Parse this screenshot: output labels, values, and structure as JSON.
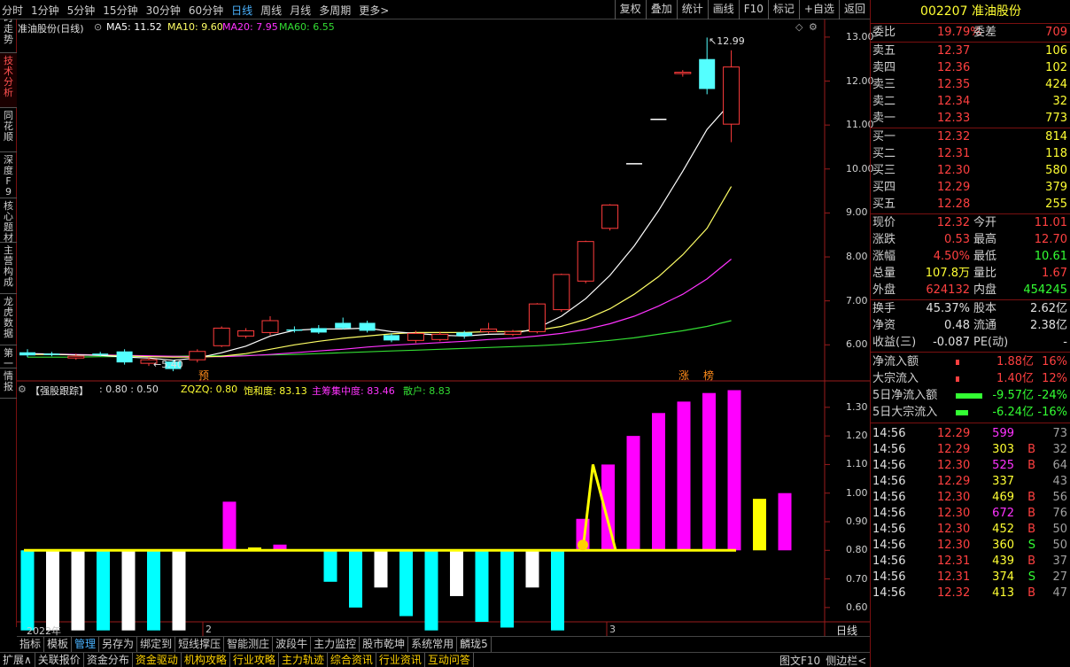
{
  "toolbar": {
    "periods": [
      "分时",
      "1分钟",
      "5分钟",
      "15分钟",
      "30分钟",
      "60分钟",
      "日线",
      "周线",
      "月线",
      "多周期",
      "更多>"
    ],
    "active_period": "日线",
    "right_tools": [
      "复权",
      "叠加",
      "统计",
      "画线",
      "F10",
      "标记",
      "+自选",
      "返回"
    ]
  },
  "left_tabs": [
    {
      "label": "分时走势",
      "active": false
    },
    {
      "label": "技术分析",
      "active": true
    },
    {
      "label": "同花顺",
      "active": false
    },
    {
      "label": "深度F9",
      "active": false
    },
    {
      "label": "核心题材",
      "active": false
    },
    {
      "label": "主营构成",
      "active": false
    },
    {
      "label": "龙虎数据",
      "active": false
    },
    {
      "label": "第一",
      "active": false
    },
    {
      "label": "情报",
      "active": false
    }
  ],
  "main_header": {
    "title": "准油股份(日线)",
    "ma5": "MA5: 11.52",
    "ma10": "MA10: 9.60",
    "ma20": "MA20: 7.95",
    "ma60": "MA60: 6.55"
  },
  "price_axis": [
    "13.00",
    "12.00",
    "11.00",
    "10.00",
    "9.00",
    "8.00",
    "7.00",
    "6.00"
  ],
  "high_mark": "12.99",
  "low_mark": "5.40",
  "event_marks": {
    "pre": "预",
    "up": "涨",
    "rank": "榜"
  },
  "sub_header": {
    "name": "【强股跟踪】",
    "vals": ": 0.80 : 0.50",
    "zqzq": "ZQZQ: 0.80",
    "bhd": "饱和度: 83.13",
    "zczd": "主筹集中度: 83.46",
    "sh": "散户: 8.83"
  },
  "sub_axis": [
    "1.30",
    "1.20",
    "1.10",
    "1.00",
    "0.90",
    "0.80",
    "0.70",
    "0.60"
  ],
  "sub_footer": "日线",
  "date_labels": [
    "2022年",
    "2",
    "3"
  ],
  "colors": {
    "up": "#ff3c3c",
    "down": "#54ffff",
    "ma5": "#ffffff",
    "ma10": "#ffff66",
    "ma20": "#ff33ff",
    "ma60": "#33dd33",
    "sub_magenta": "#ff00ff",
    "sub_cyan": "#00ffff",
    "sub_white": "#ffffff",
    "sub_yellow": "#ffff00"
  },
  "chart_data": [
    {
      "type": "candlestick",
      "title": "准油股份(日线)",
      "ylim": [
        5.2,
        13.3
      ],
      "candles": [
        {
          "o": 5.83,
          "c": 5.76,
          "h": 5.9,
          "l": 5.72
        },
        {
          "o": 5.8,
          "c": 5.78,
          "h": 5.84,
          "l": 5.74
        },
        {
          "o": 5.7,
          "c": 5.74,
          "h": 5.8,
          "l": 5.66
        },
        {
          "o": 5.8,
          "c": 5.78,
          "h": 5.84,
          "l": 5.74
        },
        {
          "o": 5.85,
          "c": 5.6,
          "h": 5.9,
          "l": 5.55
        },
        {
          "o": 5.58,
          "c": 5.66,
          "h": 5.72,
          "l": 5.52
        },
        {
          "o": 5.62,
          "c": 5.45,
          "h": 5.66,
          "l": 5.4
        },
        {
          "o": 5.66,
          "c": 5.85,
          "h": 5.9,
          "l": 5.6
        },
        {
          "o": 5.98,
          "c": 6.38,
          "h": 6.42,
          "l": 5.95
        },
        {
          "o": 6.2,
          "c": 6.32,
          "h": 6.38,
          "l": 6.15
        },
        {
          "o": 6.28,
          "c": 6.55,
          "h": 6.65,
          "l": 6.22
        },
        {
          "o": 6.35,
          "c": 6.34,
          "h": 6.42,
          "l": 6.28
        },
        {
          "o": 6.38,
          "c": 6.28,
          "h": 6.45,
          "l": 6.25
        },
        {
          "o": 6.5,
          "c": 6.38,
          "h": 6.62,
          "l": 6.35
        },
        {
          "o": 6.5,
          "c": 6.32,
          "h": 6.55,
          "l": 6.28
        },
        {
          "o": 6.22,
          "c": 6.1,
          "h": 6.26,
          "l": 6.06
        },
        {
          "o": 6.1,
          "c": 6.26,
          "h": 6.32,
          "l": 6.04
        },
        {
          "o": 6.12,
          "c": 6.24,
          "h": 6.3,
          "l": 6.08
        },
        {
          "o": 6.28,
          "c": 6.2,
          "h": 6.32,
          "l": 6.14
        },
        {
          "o": 6.3,
          "c": 6.36,
          "h": 6.5,
          "l": 6.26
        },
        {
          "o": 6.24,
          "c": 6.3,
          "h": 6.34,
          "l": 6.2
        },
        {
          "o": 6.3,
          "c": 6.93,
          "h": 6.95,
          "l": 6.26
        },
        {
          "o": 6.8,
          "c": 7.6,
          "h": 7.62,
          "l": 6.75
        },
        {
          "o": 7.45,
          "c": 8.35,
          "h": 8.37,
          "l": 7.4
        },
        {
          "o": 8.65,
          "c": 9.18,
          "h": 9.2,
          "l": 8.6
        },
        {
          "o": 10.12,
          "c": 10.12,
          "h": 10.12,
          "l": 10.12
        },
        {
          "o": 11.13,
          "c": 11.13,
          "h": 11.13,
          "l": 11.13
        },
        {
          "o": 12.2,
          "c": 12.2,
          "h": 12.25,
          "l": 12.1
        },
        {
          "o": 12.5,
          "c": 11.82,
          "h": 12.99,
          "l": 11.7
        },
        {
          "o": 11.02,
          "c": 12.32,
          "h": 12.7,
          "l": 10.61
        }
      ],
      "ma5": [
        5.8,
        5.79,
        5.77,
        5.76,
        5.72,
        5.7,
        5.65,
        5.7,
        5.82,
        5.97,
        6.2,
        6.33,
        6.36,
        6.36,
        6.38,
        6.3,
        6.26,
        6.22,
        6.2,
        6.24,
        6.25,
        6.38,
        6.65,
        7.05,
        7.58,
        8.25,
        9.05,
        9.95,
        10.9,
        11.52
      ],
      "ma10": [
        5.78,
        5.78,
        5.77,
        5.76,
        5.75,
        5.73,
        5.72,
        5.72,
        5.74,
        5.8,
        5.9,
        6.0,
        6.08,
        6.15,
        6.2,
        6.25,
        6.28,
        6.28,
        6.28,
        6.3,
        6.3,
        6.33,
        6.42,
        6.58,
        6.82,
        7.15,
        7.55,
        8.05,
        8.65,
        9.6
      ],
      "ma20": [
        5.8,
        5.79,
        5.78,
        5.77,
        5.76,
        5.75,
        5.74,
        5.73,
        5.73,
        5.75,
        5.78,
        5.82,
        5.86,
        5.9,
        5.95,
        5.99,
        6.02,
        6.05,
        6.08,
        6.12,
        6.15,
        6.2,
        6.26,
        6.35,
        6.48,
        6.65,
        6.88,
        7.15,
        7.5,
        7.95
      ],
      "ma60": [
        5.72,
        5.72,
        5.72,
        5.73,
        5.73,
        5.74,
        5.74,
        5.75,
        5.75,
        5.76,
        5.77,
        5.78,
        5.8,
        5.82,
        5.84,
        5.86,
        5.88,
        5.9,
        5.92,
        5.94,
        5.96,
        5.98,
        6.01,
        6.05,
        6.1,
        6.16,
        6.24,
        6.32,
        6.42,
        6.55
      ]
    },
    {
      "type": "bar",
      "title": "【强股跟踪】",
      "ylim": [
        0.55,
        1.38
      ],
      "baseline": 0.8,
      "values": [
        0.52,
        0.52,
        0.52,
        0.52,
        0.52,
        0.52,
        0.52,
        0.8,
        0.97,
        0.81,
        0.82,
        0.8,
        0.69,
        0.6,
        0.67,
        0.57,
        0.52,
        0.64,
        0.55,
        0.53,
        0.67,
        0.52,
        0.91,
        1.1,
        1.2,
        1.28,
        1.32,
        1.35,
        1.36,
        0.98,
        1.0
      ],
      "colors": [
        "c",
        "w",
        "w",
        "c",
        "w",
        "c",
        "w",
        "n",
        "m",
        "y",
        "m",
        "n",
        "c",
        "c",
        "w",
        "c",
        "c",
        "w",
        "c",
        "c",
        "w",
        "c",
        "m",
        "m",
        "m",
        "m",
        "m",
        "m",
        "m",
        "y",
        "m"
      ],
      "peak": [
        {
          "x": 22,
          "y": 0.8
        },
        {
          "x": 22.4,
          "y": 1.1
        },
        {
          "x": 23.3,
          "y": 0.8
        }
      ]
    }
  ],
  "quote": {
    "code": "002207",
    "name": "准油股份",
    "weibi_label": "委比",
    "weibi_value": "19.79%",
    "weicha_label": "委差",
    "weicha_value": "709",
    "sell": [
      {
        "label": "卖五",
        "price": "12.37",
        "vol": "106"
      },
      {
        "label": "卖四",
        "price": "12.36",
        "vol": "102"
      },
      {
        "label": "卖三",
        "price": "12.35",
        "vol": "424"
      },
      {
        "label": "卖二",
        "price": "12.34",
        "vol": "32"
      },
      {
        "label": "卖一",
        "price": "12.33",
        "vol": "773"
      }
    ],
    "buy": [
      {
        "label": "买一",
        "price": "12.32",
        "vol": "814"
      },
      {
        "label": "买二",
        "price": "12.31",
        "vol": "118"
      },
      {
        "label": "买三",
        "price": "12.30",
        "vol": "580"
      },
      {
        "label": "买四",
        "price": "12.29",
        "vol": "379"
      },
      {
        "label": "买五",
        "price": "12.28",
        "vol": "255"
      }
    ],
    "stats": [
      {
        "l1": "现价",
        "v1": "12.32",
        "c1": "#ff4040",
        "l2": "今开",
        "v2": "11.01",
        "c2": "#ff4040"
      },
      {
        "l1": "涨跌",
        "v1": "0.53",
        "c1": "#ff4040",
        "l2": "最高",
        "v2": "12.70",
        "c2": "#ff4040"
      },
      {
        "l1": "涨幅",
        "v1": "4.50%",
        "c1": "#ff4040",
        "l2": "最低",
        "v2": "10.61",
        "c2": "#33ff33"
      },
      {
        "l1": "总量",
        "v1": "107.8万",
        "c1": "#ffff33",
        "l2": "量比",
        "v2": "1.67",
        "c2": "#ff4040"
      },
      {
        "l1": "外盘",
        "v1": "624132",
        "c1": "#ff4040",
        "l2": "内盘",
        "v2": "454245",
        "c2": "#33ff33"
      }
    ],
    "stats2": [
      {
        "l1": "换手",
        "v1": "45.37%",
        "l2": "股本",
        "v2": "2.62亿"
      },
      {
        "l1": "净资",
        "v1": "0.48",
        "l2": "流通",
        "v2": "2.38亿"
      },
      {
        "l1": "收益(三)",
        "v1": "-0.087",
        "l2": "PE(动)",
        "v2": "-"
      }
    ],
    "flows": [
      {
        "label": "净流入额",
        "value": "1.88亿",
        "pct": "16%",
        "color": "#ff4040",
        "bar": 0.06
      },
      {
        "label": "大宗流入",
        "value": "1.40亿",
        "pct": "12%",
        "color": "#ff4040",
        "bar": 0.05
      },
      {
        "label": "5日净流入额",
        "value": "-9.57亿",
        "pct": "-24%",
        "color": "#33ff33",
        "bar": 1
      },
      {
        "label": "5日大宗流入",
        "value": "-6.24亿",
        "pct": "-16%",
        "color": "#33ff33",
        "bar": 0.45
      }
    ],
    "ticks": [
      {
        "t": "14:56",
        "p": "12.29",
        "v": "599",
        "f": "",
        "n": "73",
        "vc": "#ff33ff"
      },
      {
        "t": "14:56",
        "p": "12.29",
        "v": "303",
        "f": "B",
        "n": "32",
        "vc": "#ffff33"
      },
      {
        "t": "14:56",
        "p": "12.30",
        "v": "525",
        "f": "B",
        "n": "64",
        "vc": "#ff33ff"
      },
      {
        "t": "14:56",
        "p": "12.29",
        "v": "337",
        "f": "",
        "n": "43",
        "vc": "#ffff33"
      },
      {
        "t": "14:56",
        "p": "12.30",
        "v": "469",
        "f": "B",
        "n": "56",
        "vc": "#ffff33"
      },
      {
        "t": "14:56",
        "p": "12.30",
        "v": "672",
        "f": "B",
        "n": "76",
        "vc": "#ff33ff"
      },
      {
        "t": "14:56",
        "p": "12.30",
        "v": "452",
        "f": "B",
        "n": "50",
        "vc": "#ffff33"
      },
      {
        "t": "14:56",
        "p": "12.30",
        "v": "360",
        "f": "S",
        "n": "50",
        "vc": "#ffff33"
      },
      {
        "t": "14:56",
        "p": "12.31",
        "v": "439",
        "f": "B",
        "n": "37",
        "vc": "#ffff33"
      },
      {
        "t": "14:56",
        "p": "12.31",
        "v": "374",
        "f": "S",
        "n": "27",
        "vc": "#ffff33"
      },
      {
        "t": "14:56",
        "p": "12.32",
        "v": "413",
        "f": "B",
        "n": "47",
        "vc": "#ffff33"
      }
    ]
  },
  "tabs1": [
    "指标",
    "模板",
    "管理",
    "另存为",
    "绑定到",
    "短线撑压",
    "智能测庄",
    "波段牛",
    "主力监控",
    "股市乾坤",
    "系统常用",
    "麟珑5"
  ],
  "tabs1_active": "管理",
  "tabs2": [
    "扩展∧",
    "关联报价",
    "资金分布",
    "资金驱动",
    "机构攻略",
    "行业攻略",
    "主力轨迹",
    "综合资讯",
    "行业资讯",
    "互动问答"
  ],
  "tabs2_yellow": [
    "资金驱动",
    "机构攻略",
    "行业攻略",
    "主力轨迹",
    "综合资讯",
    "行业资讯",
    "互动问答"
  ],
  "bottom_right": [
    "图文F10",
    "侧边栏<"
  ]
}
